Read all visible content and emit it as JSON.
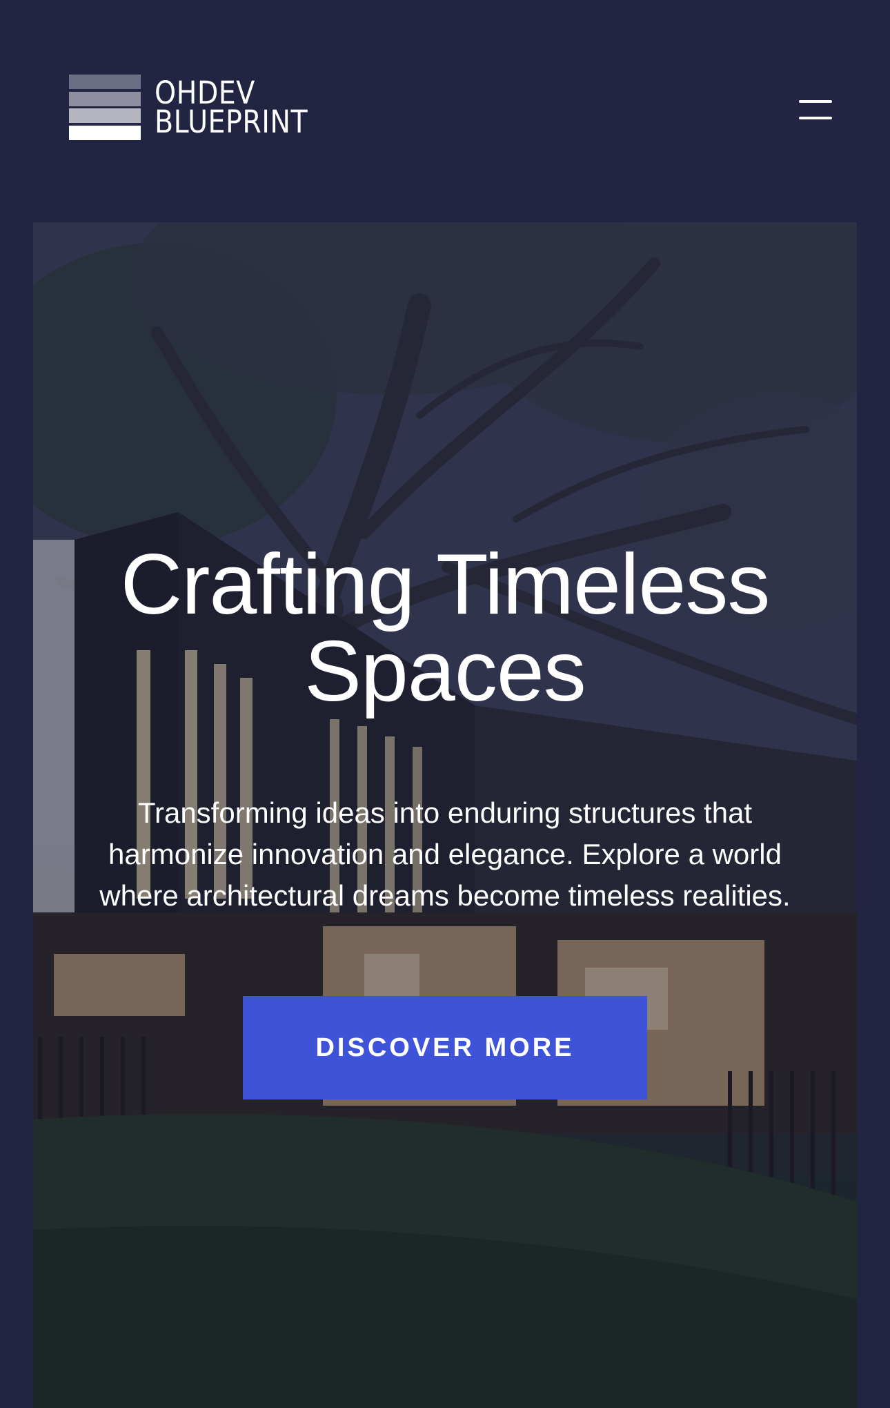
{
  "header": {
    "logo": {
      "line1": "OHDEV",
      "line2": "BLUEPRINT",
      "icon": "stacked-bars-logo"
    },
    "menu_icon": "hamburger-menu-icon"
  },
  "hero": {
    "title_line1": "Crafting Timeless",
    "title_line2": "Spaces",
    "subtitle_line1": "Transforming ideas into enduring structures that",
    "subtitle_line2": "harmonize innovation and elegance. Explore a world",
    "subtitle_line3": "where architectural dreams become timeless realities.",
    "cta_label": "DISCOVER MORE",
    "background_image": "modern-house-at-dusk-with-tree"
  },
  "colors": {
    "page_background": "#222542",
    "accent": "#3f53d9",
    "text": "#ffffff"
  }
}
